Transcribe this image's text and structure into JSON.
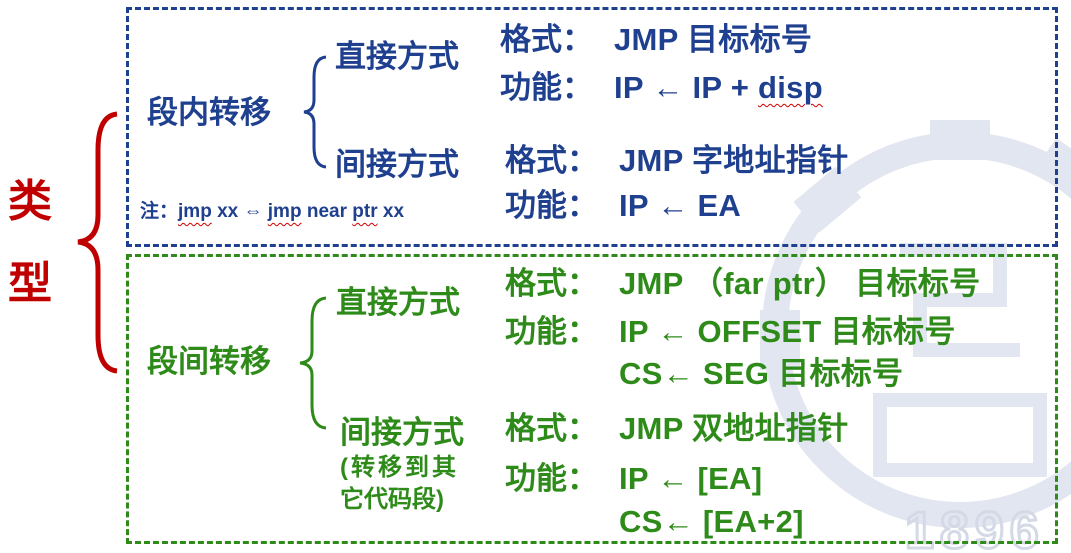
{
  "type_label": [
    "类",
    "型"
  ],
  "intra": {
    "title": "段内转移",
    "note": {
      "prefix": "注：",
      "code_a": "jmp",
      "text_a": " xx ",
      "arrow": "⇔",
      "sp": " ",
      "code_b": "jmp",
      "text_b": " near ",
      "code_c": "ptr",
      "text_c": " xx"
    },
    "direct": {
      "title": "直接方式",
      "format_label": "格式：",
      "format_value": "JMP  目标标号",
      "func_label": "功能：",
      "func_a": "IP ← IP + ",
      "func_b": "disp"
    },
    "indirect": {
      "title": "间接方式",
      "format_label": "格式：",
      "format_value": "JMP  字地址指针",
      "func_label": "功能：",
      "func_value": "IP ← EA"
    }
  },
  "inter": {
    "title": "段间转移",
    "direct": {
      "title": "直接方式",
      "format_label": "格式：",
      "format_value": "JMP  （far ptr） 目标标号",
      "func_label": "功能：",
      "func_line1": "IP ← OFFSET 目标标号",
      "func_line2": "CS← SEG 目标标号"
    },
    "indirect": {
      "title": "间接方式",
      "subtitle_line1": "(转移到其",
      "subtitle_line2": "它代码段)",
      "format_label": "格式：",
      "format_value": "JMP 双地址指针",
      "func_label": "功能：",
      "func_line1": "IP ← [EA]",
      "func_line2": "CS← [EA+2]"
    }
  },
  "watermark": {
    "year": "1896",
    "kind": "gear-logo"
  },
  "colors": {
    "blue": "#1f3f8f",
    "green": "#2e8b1a",
    "red": "#c00000",
    "watermark": "#dfe3ee"
  }
}
